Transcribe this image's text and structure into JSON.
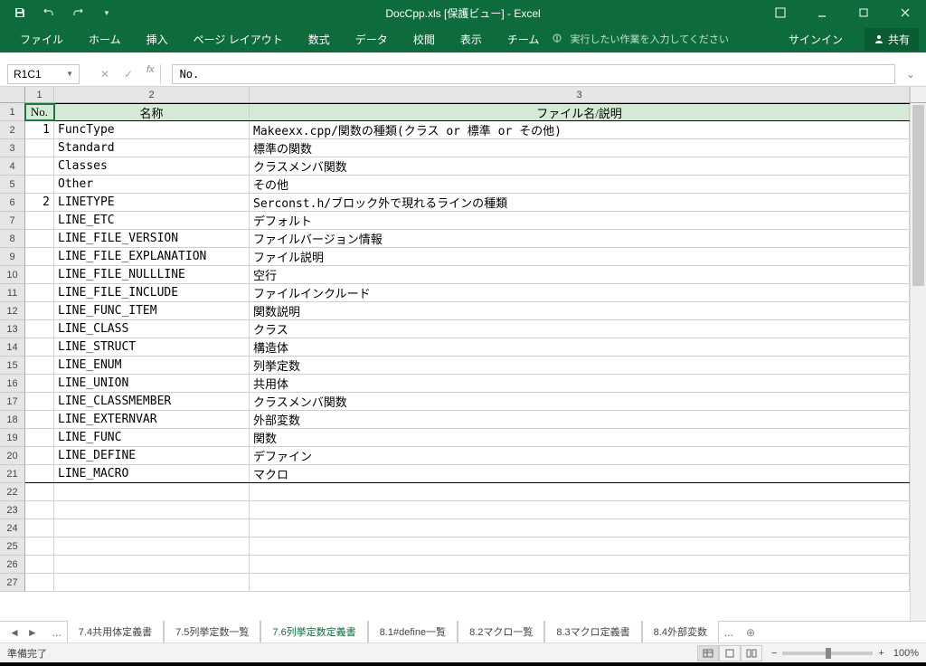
{
  "title": "DocCpp.xls  [保護ビュー] - Excel",
  "qat": {
    "save": "保存",
    "undo": "元に戻す",
    "redo": "やり直し"
  },
  "ribbon": {
    "tabs": [
      "ファイル",
      "ホーム",
      "挿入",
      "ページ レイアウト",
      "数式",
      "データ",
      "校閲",
      "表示",
      "チーム"
    ],
    "tellme": "実行したい作業を入力してください",
    "signin": "サインイン",
    "share": "共有"
  },
  "namebox": "R1C1",
  "formula": "No.",
  "columns": [
    "1",
    "2",
    "3"
  ],
  "header_row": {
    "no": "No.",
    "name": "名称",
    "desc": "ファイル名/説明"
  },
  "rows": [
    {
      "no": "1",
      "name": "FuncType",
      "desc": "Makeexx.cpp/関数の種類(クラス or 標準 or その他)"
    },
    {
      "no": "",
      "name": "Standard",
      "desc": "標準の関数"
    },
    {
      "no": "",
      "name": "Classes",
      "desc": "クラスメンバ関数"
    },
    {
      "no": "",
      "name": "Other",
      "desc": "その他"
    },
    {
      "no": "2",
      "name": "LINETYPE",
      "desc": "Serconst.h/ブロック外で現れるラインの種類"
    },
    {
      "no": "",
      "name": "LINE_ETC",
      "desc": "デフォルト"
    },
    {
      "no": "",
      "name": "LINE_FILE_VERSION",
      "desc": "ファイルバージョン情報"
    },
    {
      "no": "",
      "name": "LINE_FILE_EXPLANATION",
      "desc": "ファイル説明"
    },
    {
      "no": "",
      "name": "LINE_FILE_NULLLINE",
      "desc": "空行"
    },
    {
      "no": "",
      "name": "LINE_FILE_INCLUDE",
      "desc": "ファイルインクルード"
    },
    {
      "no": "",
      "name": "LINE_FUNC_ITEM",
      "desc": "関数説明"
    },
    {
      "no": "",
      "name": "LINE_CLASS",
      "desc": "クラス"
    },
    {
      "no": "",
      "name": "LINE_STRUCT",
      "desc": "構造体"
    },
    {
      "no": "",
      "name": "LINE_ENUM",
      "desc": "列挙定数"
    },
    {
      "no": "",
      "name": "LINE_UNION",
      "desc": "共用体"
    },
    {
      "no": "",
      "name": "LINE_CLASSMEMBER",
      "desc": "クラスメンバ関数"
    },
    {
      "no": "",
      "name": "LINE_EXTERNVAR",
      "desc": "外部変数"
    },
    {
      "no": "",
      "name": "LINE_FUNC",
      "desc": "関数"
    },
    {
      "no": "",
      "name": "LINE_DEFINE",
      "desc": "デファイン"
    },
    {
      "no": "",
      "name": "LINE_MACRO",
      "desc": "マクロ"
    }
  ],
  "empty_rows": 6,
  "row_numbers": [
    "1",
    "2",
    "3",
    "4",
    "5",
    "6",
    "7",
    "8",
    "9",
    "10",
    "11",
    "12",
    "13",
    "14",
    "15",
    "16",
    "17",
    "18",
    "19",
    "20",
    "21",
    "22",
    "23",
    "24",
    "25",
    "26",
    "27"
  ],
  "sheets": {
    "tabs": [
      "7.4共用体定義書",
      "7.5列挙定数一覧",
      "7.6列挙定数定義書",
      "8.1#define一覧",
      "8.2マクロ一覧",
      "8.3マクロ定義書",
      "8.4外部変数"
    ],
    "active": 2,
    "ellipsis_start": "...",
    "ellipsis_end": "..."
  },
  "status": {
    "ready": "準備完了",
    "zoom": "100%"
  }
}
